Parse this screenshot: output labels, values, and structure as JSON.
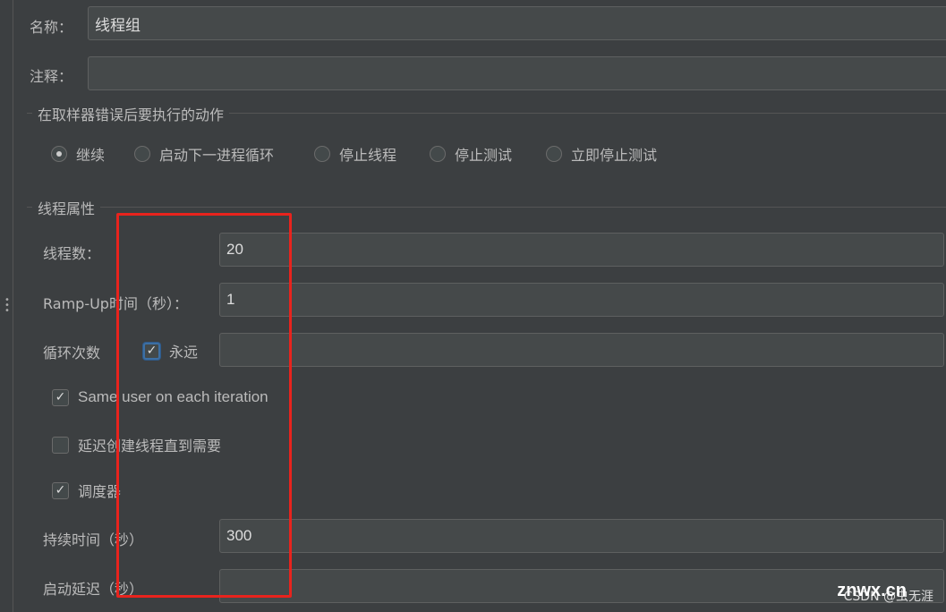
{
  "name": {
    "label": "名称：",
    "value": "线程组"
  },
  "comment": {
    "label": "注释：",
    "value": ""
  },
  "sampler_error": {
    "title": "在取样器错误后要执行的动作",
    "options": [
      {
        "label": "继续",
        "selected": true
      },
      {
        "label": "启动下一进程循环",
        "selected": false
      },
      {
        "label": "停止线程",
        "selected": false
      },
      {
        "label": "停止测试",
        "selected": false
      },
      {
        "label": "立即停止测试",
        "selected": false
      }
    ]
  },
  "thread_props": {
    "title": "线程属性",
    "threads": {
      "label": "线程数：",
      "value": "20"
    },
    "rampup": {
      "label": "Ramp-Up时间（秒）：",
      "value": "1"
    },
    "loop": {
      "label": "循环次数",
      "forever_label": "永远",
      "forever_checked": true,
      "value": ""
    },
    "same_user": {
      "label": "Same user on each iteration",
      "checked": true
    },
    "delay_create": {
      "label": "延迟创建线程直到需要",
      "checked": false
    },
    "scheduler": {
      "label": "调度器",
      "checked": true
    },
    "duration": {
      "label": "持续时间（秒）",
      "value": "300"
    },
    "startup_delay": {
      "label": "启动延迟（秒）",
      "value": ""
    }
  },
  "highlight_color": "#e8231d",
  "watermark": {
    "text": "CSDN @虫无涯",
    "logo": "znwx.cn"
  }
}
